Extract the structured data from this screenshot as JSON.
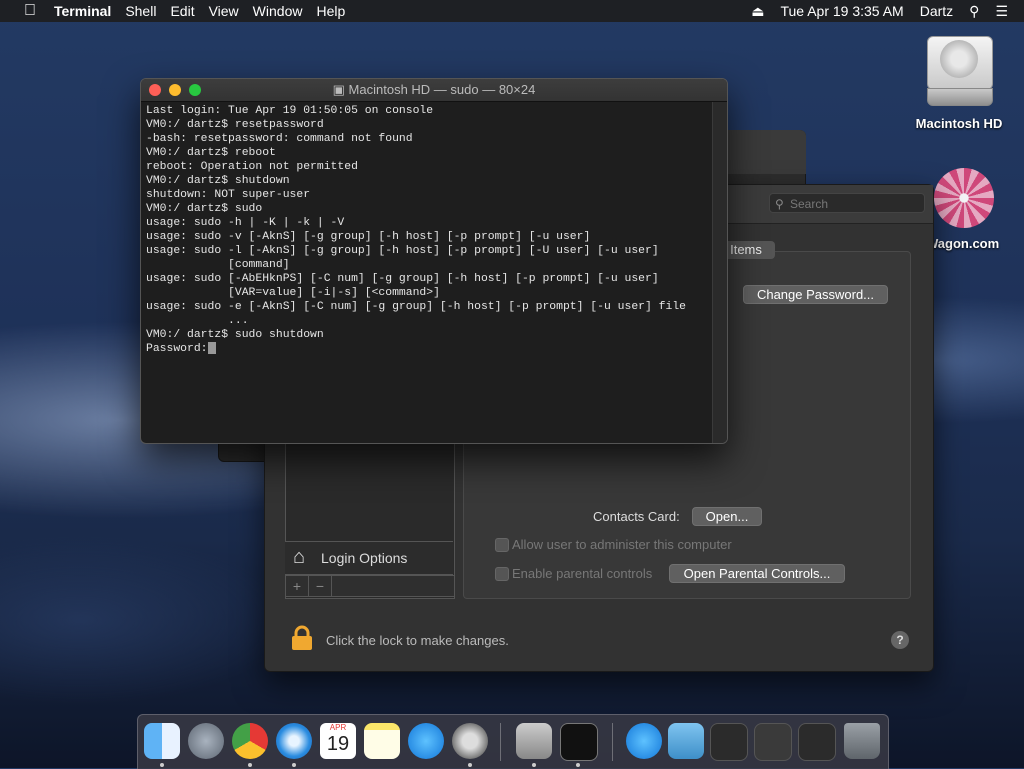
{
  "menubar": {
    "app": "Terminal",
    "items": [
      "Shell",
      "Edit",
      "View",
      "Window",
      "Help"
    ],
    "datetime": "Tue Apr 19  3:35 AM",
    "user": "Dartz"
  },
  "desktop": {
    "hd_label": "Macintosh HD",
    "wagon_label": "Wagon.com"
  },
  "terminal": {
    "title": "Macintosh HD — sudo — 80×24",
    "lines": [
      "Last login: Tue Apr 19 01:50:05 on console",
      "VM0:/ dartz$ resetpassword",
      "-bash: resetpassword: command not found",
      "VM0:/ dartz$ reboot",
      "reboot: Operation not permitted",
      "VM0:/ dartz$ shutdown",
      "shutdown: NOT super-user",
      "VM0:/ dartz$ sudo",
      "usage: sudo -h | -K | -k | -V",
      "usage: sudo -v [-AknS] [-g group] [-h host] [-p prompt] [-u user]",
      "usage: sudo -l [-AknS] [-g group] [-h host] [-p prompt] [-U user] [-u user]",
      "            [command]",
      "usage: sudo [-AbEHknPS] [-C num] [-g group] [-h host] [-p prompt] [-u user]",
      "            [VAR=value] [-i|-s] [<command>]",
      "usage: sudo -e [-AknS] [-C num] [-g group] [-h host] [-p prompt] [-u user] file",
      "            ...",
      "VM0:/ dartz$ sudo shutdown",
      "Password:"
    ]
  },
  "prefs": {
    "search_placeholder": "Search",
    "tab_items": "Items",
    "change_password": "Change Password...",
    "contacts_card_label": "Contacts Card:",
    "open_button": "Open...",
    "allow_admin": "Allow user to administer this computer",
    "enable_parental": "Enable parental controls",
    "open_parental": "Open Parental Controls...",
    "login_options": "Login Options",
    "lock_text": "Click the lock to make changes.",
    "help": "?"
  },
  "dock": {
    "calendar_month": "APR",
    "calendar_day": "19"
  },
  "colors": {
    "close": "#fe5f57",
    "minimize": "#febc2e",
    "zoom": "#28c840"
  }
}
